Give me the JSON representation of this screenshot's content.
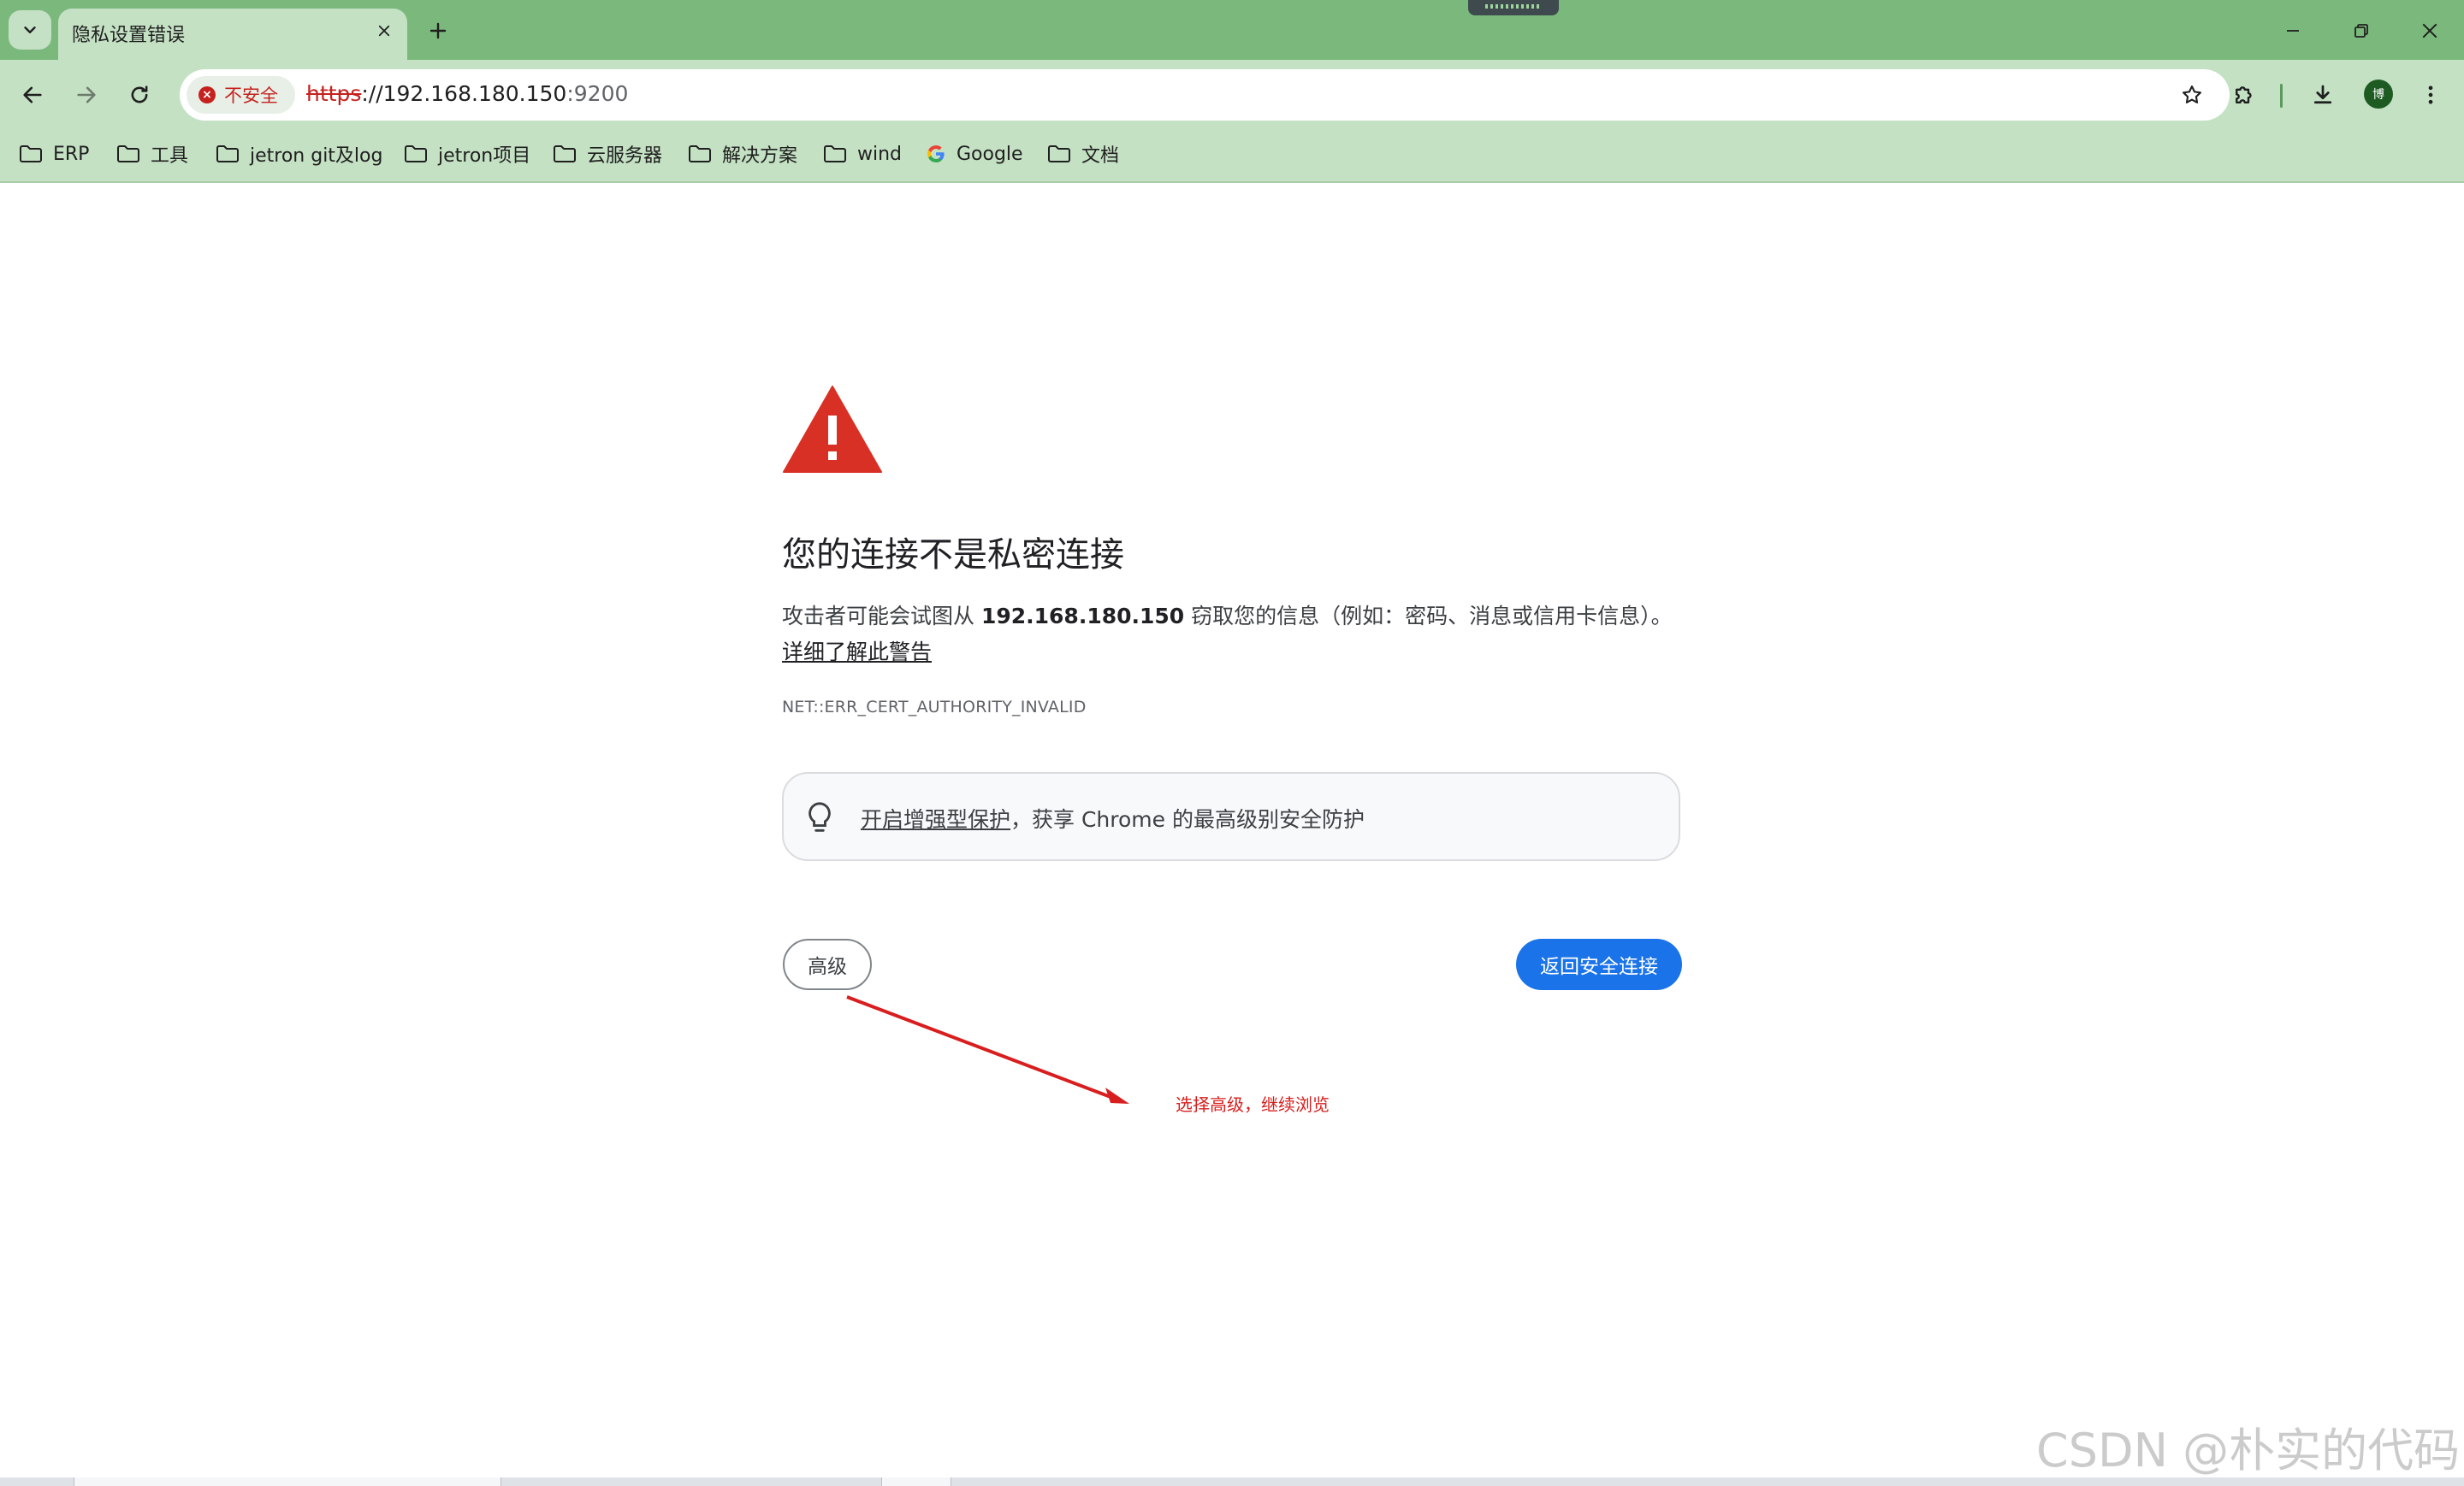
{
  "browser": {
    "tab_title": "隐私设置错误",
    "security_chip": "不安全",
    "url": {
      "scheme": "https",
      "rest": "://192.168.180.150",
      "port": ":9200"
    },
    "avatar_initial": "博",
    "accent_color": "#7ab87c"
  },
  "bookmarks": [
    {
      "label": "ERP",
      "icon": "folder-icon"
    },
    {
      "label": "工具",
      "icon": "folder-icon"
    },
    {
      "label": "jetron git及log",
      "icon": "folder-icon"
    },
    {
      "label": "jetron项目",
      "icon": "folder-icon"
    },
    {
      "label": "云服务器",
      "icon": "folder-icon"
    },
    {
      "label": "解决方案",
      "icon": "folder-icon"
    },
    {
      "label": "wind",
      "icon": "folder-icon"
    },
    {
      "label": "Google",
      "icon": "google-icon"
    },
    {
      "label": "文档",
      "icon": "folder-icon"
    }
  ],
  "interstitial": {
    "heading": "您的连接不是私密连接",
    "desc_prefix": "攻击者可能会试图从 ",
    "desc_host": "192.168.180.150",
    "desc_suffix": " 窃取您的信息（例如：密码、消息或信用卡信息）。",
    "learn_more": "详细了解此警告",
    "error_code": "NET::ERR_CERT_AUTHORITY_INVALID",
    "enhanced_link": "开启增强型保护",
    "enhanced_rest": "，获享 Chrome 的最高级别安全防护",
    "advanced_button": "高级",
    "back_button": "返回安全连接",
    "warning_color": "#d93025",
    "primary_color": "#1a73e8"
  },
  "annotation": {
    "text": "选择高级，继续浏览",
    "color": "#d81e1e"
  },
  "watermark": "CSDN @朴实的代码"
}
